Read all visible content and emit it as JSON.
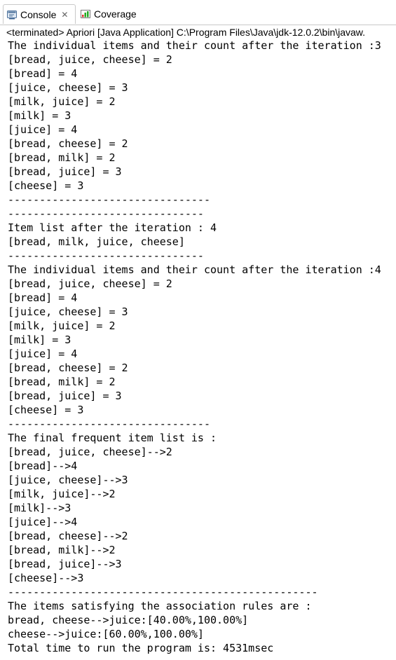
{
  "tabs": [
    {
      "label": "Console",
      "icon": "console-icon",
      "active": true
    },
    {
      "label": "Coverage",
      "icon": "coverage-icon",
      "active": false
    }
  ],
  "status": "<terminated> Apriori [Java Application] C:\\Program Files\\Java\\jdk-12.0.2\\bin\\javaw.",
  "console_lines": [
    "The individual items and their count after the iteration :3",
    "[bread, juice, cheese] = 2",
    "[bread] = 4",
    "[juice, cheese] = 3",
    "[milk, juice] = 2",
    "[milk] = 3",
    "[juice] = 4",
    "[bread, cheese] = 2",
    "[bread, milk] = 2",
    "[bread, juice] = 3",
    "[cheese] = 3",
    "--------------------------------",
    "-------------------------------",
    "Item list after the iteration : 4",
    "[bread, milk, juice, cheese]",
    "-------------------------------",
    "The individual items and their count after the iteration :4",
    "[bread, juice, cheese] = 2",
    "[bread] = 4",
    "[juice, cheese] = 3",
    "[milk, juice] = 2",
    "[milk] = 3",
    "[juice] = 4",
    "[bread, cheese] = 2",
    "[bread, milk] = 2",
    "[bread, juice] = 3",
    "[cheese] = 3",
    "--------------------------------",
    "The final frequent item list is :",
    "[bread, juice, cheese]-->2",
    "[bread]-->4",
    "[juice, cheese]-->3",
    "[milk, juice]-->2",
    "[milk]-->3",
    "[juice]-->4",
    "[bread, cheese]-->2",
    "[bread, milk]-->2",
    "[bread, juice]-->3",
    "[cheese]-->3",
    "-------------------------------------------------",
    "The items satisfying the association rules are :",
    "bread, cheese-->juice:[40.00%,100.00%]",
    "cheese-->juice:[60.00%,100.00%]",
    "Total time to run the program is: 4531msec"
  ]
}
